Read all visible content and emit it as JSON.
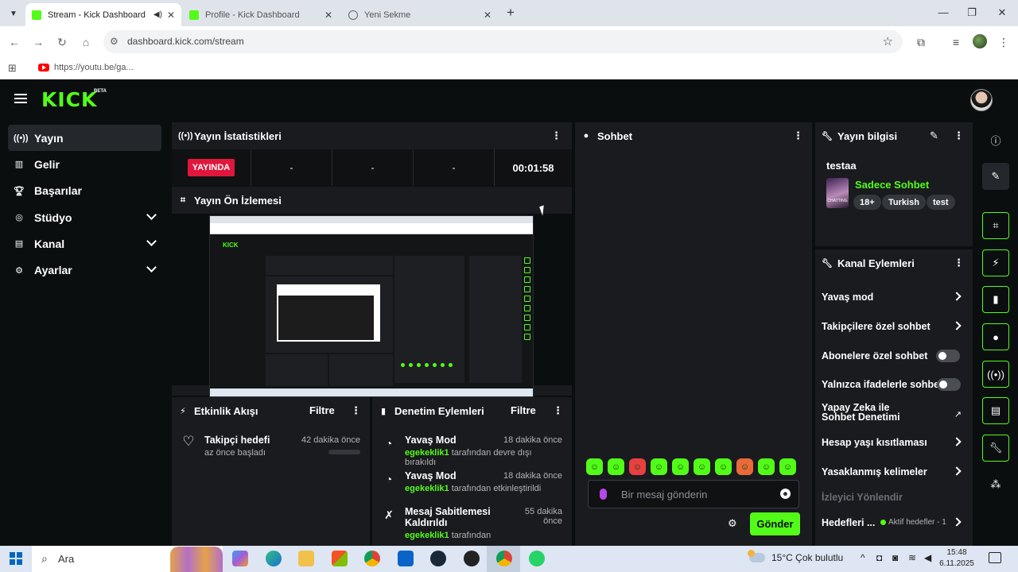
{
  "browser": {
    "tabs": [
      {
        "label": "Stream - Kick Dashboard",
        "active": true
      },
      {
        "label": "Profile - Kick Dashboard",
        "active": false
      },
      {
        "label": "Yeni Sekme",
        "active": false
      }
    ],
    "url": "dashboard.kick.com/stream",
    "bookmark": "https://youtu.be/ga..."
  },
  "app": {
    "logo": "KICK",
    "logo_badge": "BETA"
  },
  "sidebar": {
    "items": [
      {
        "label": "Yayın",
        "icon": "broadcast-icon"
      },
      {
        "label": "Gelir",
        "icon": "chart-icon"
      },
      {
        "label": "Başarılar",
        "icon": "trophy-icon"
      },
      {
        "label": "Stüdyo",
        "icon": "studio-icon"
      },
      {
        "label": "Kanal",
        "icon": "channel-icon"
      },
      {
        "label": "Ayarlar",
        "icon": "gear-icon"
      }
    ]
  },
  "stats": {
    "title": "Yayın İstatistikleri",
    "live_label": "YAYINDA",
    "cells": [
      "-",
      "-",
      "-"
    ],
    "duration": "00:01:58"
  },
  "preview": {
    "title": "Yayın Ön İzlemesi"
  },
  "activity": {
    "title": "Etkinlik Akışı",
    "filter": "Filtre",
    "items": [
      {
        "title": "Takipçi hedefi",
        "sub": "az önce başladı",
        "time": "42 dakika önce"
      }
    ]
  },
  "moderation": {
    "title": "Denetim Eylemleri",
    "filter": "Filtre",
    "items": [
      {
        "title": "Yavaş Mod",
        "user": "egekeklik1",
        "text": "tarafından devre dışı bırakıldı",
        "time": "18 dakika önce"
      },
      {
        "title": "Yavaş Mod",
        "user": "egekeklik1",
        "text": "tarafından etkinleştirildi",
        "time": "18 dakika önce"
      },
      {
        "title": "Mesaj Sabitlemesi Kaldırıldı",
        "user": "egekeklik1",
        "text": "tarafından",
        "time_line1": "55 dakika",
        "time_line2": "önce"
      }
    ]
  },
  "chat": {
    "title": "Sohbet",
    "placeholder": "Bir mesaj gönderin",
    "send_label": "Gönder",
    "emotes": [
      "#53fc18",
      "#53fc18",
      "#e84040",
      "#53fc18",
      "#53fc18",
      "#53fc18",
      "#53fc18",
      "#e86a3a",
      "#53fc18",
      "#53fc18"
    ]
  },
  "stream_info": {
    "title": "Yayın bilgisi",
    "stream_title": "testaa",
    "category": "Sadece Sohbet",
    "thumb_label": "CHATTING",
    "tags": [
      "18+",
      "Turkish",
      "test"
    ]
  },
  "channel_actions": {
    "title": "Kanal Eylemleri",
    "items": [
      {
        "label": "Yavaş mod",
        "control": "chevron"
      },
      {
        "label": "Takipçilere özel sohbet",
        "control": "chevron"
      },
      {
        "label": "Abonelere özel sohbet",
        "control": "toggle"
      },
      {
        "label": "Yalnızca ifadelerle sohbet",
        "control": "toggle"
      },
      {
        "label": "Yapay Zeka ile Sohbet Denetimi",
        "control": "external"
      },
      {
        "label": "Hesap yaşı kısıtlaması",
        "control": "chevron"
      },
      {
        "label": "Yasaklanmış kelimeler",
        "control": "chevron"
      },
      {
        "label": "İzleyici Yönlendir",
        "control": "none"
      },
      {
        "label": "Hedefleri ...",
        "control": "chevron",
        "extra": "Aktif hedefler - 1"
      }
    ]
  },
  "taskbar": {
    "search": "Ara",
    "weather": "15°C  Çok bulutlu",
    "time": "15:48",
    "date": "6.11.2025"
  },
  "colors": {
    "accent": "#53fc18",
    "live": "#e1163c",
    "panel": "#191b1f",
    "background": "#0b0e0f"
  }
}
